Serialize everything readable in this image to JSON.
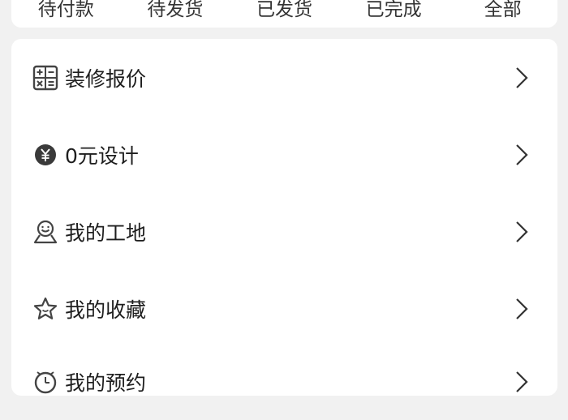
{
  "order_tabs": [
    {
      "label": "待付款"
    },
    {
      "label": "待发货"
    },
    {
      "label": "已发货"
    },
    {
      "label": "已完成"
    },
    {
      "label": "全部"
    }
  ],
  "menu": {
    "items": [
      {
        "label": "装修报价",
        "icon": "calculator-icon"
      },
      {
        "label": "0元设计",
        "icon": "yen-coin-icon"
      },
      {
        "label": "我的工地",
        "icon": "construction-site-icon"
      },
      {
        "label": "我的收藏",
        "icon": "star-icon"
      },
      {
        "label": "我的预约",
        "icon": "clock-icon"
      }
    ]
  },
  "colors": {
    "page_background": "#f1f1f1",
    "card_background": "#ffffff",
    "text": "#1e1e1e",
    "icon": "#444444"
  }
}
